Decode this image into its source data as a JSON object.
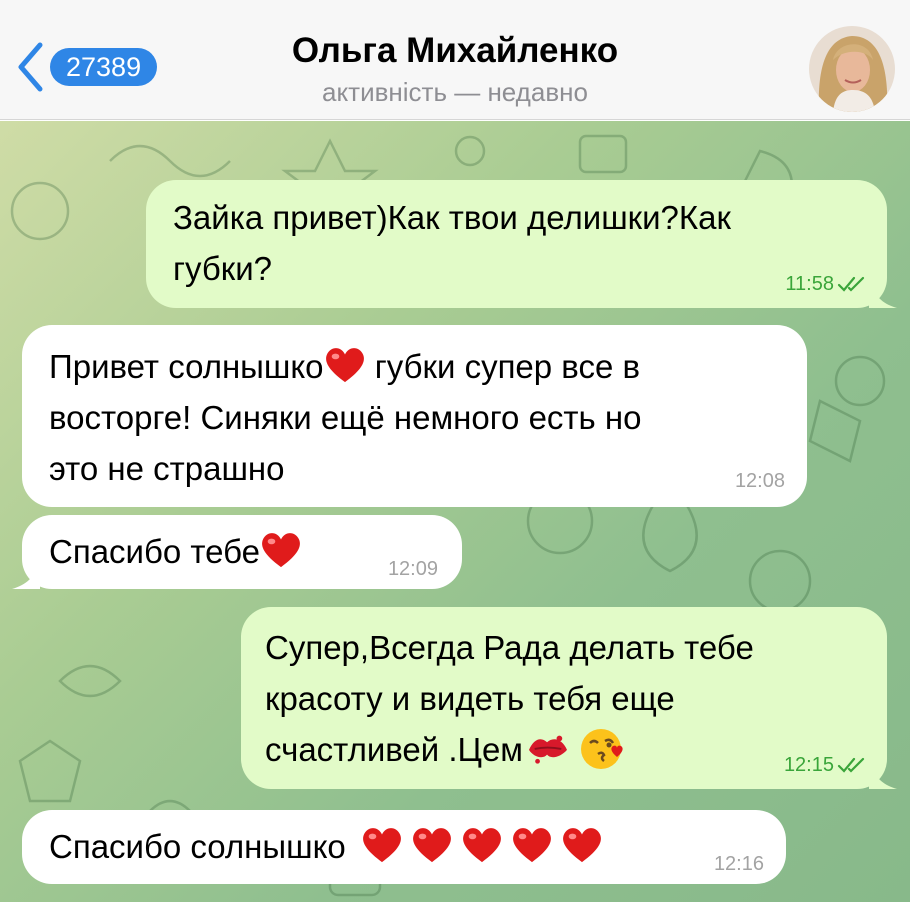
{
  "header": {
    "back_count": "27389",
    "contact_name": "Ольга Михайленко",
    "status": "активність — недавно"
  },
  "messages": [
    {
      "direction": "outgoing",
      "lines": "Зайка привет)Как твои делишки?Как\nгубки?",
      "time": "11:58",
      "read": true
    },
    {
      "direction": "incoming",
      "lines": "Привет солнышко",
      "cont": " губки супер все в\nвосторге! Синяки ещё немного есть но\nэто не страшно",
      "time": "12:08"
    },
    {
      "direction": "incoming",
      "lines": "Спасибо тебе",
      "time": "12:09"
    },
    {
      "direction": "outgoing",
      "lines": "Супер,Всегда Рада делать тебе\nкрасоту и видеть тебя еще\nсчастливей .Цем",
      "time": "12:15",
      "read": true
    },
    {
      "direction": "incoming",
      "lines": "Спасибо солнышко ",
      "time": "12:16"
    }
  ],
  "colors": {
    "outgoing_bubble": "#e2fbc8",
    "incoming_bubble": "#ffffff",
    "read_check": "#3aa53a",
    "badge": "#2f86e6"
  },
  "icons": [
    "back-chevron-icon",
    "red-heart-emoji",
    "kiss-mark-emoji",
    "face-blowing-kiss-emoji",
    "double-check-icon"
  ]
}
